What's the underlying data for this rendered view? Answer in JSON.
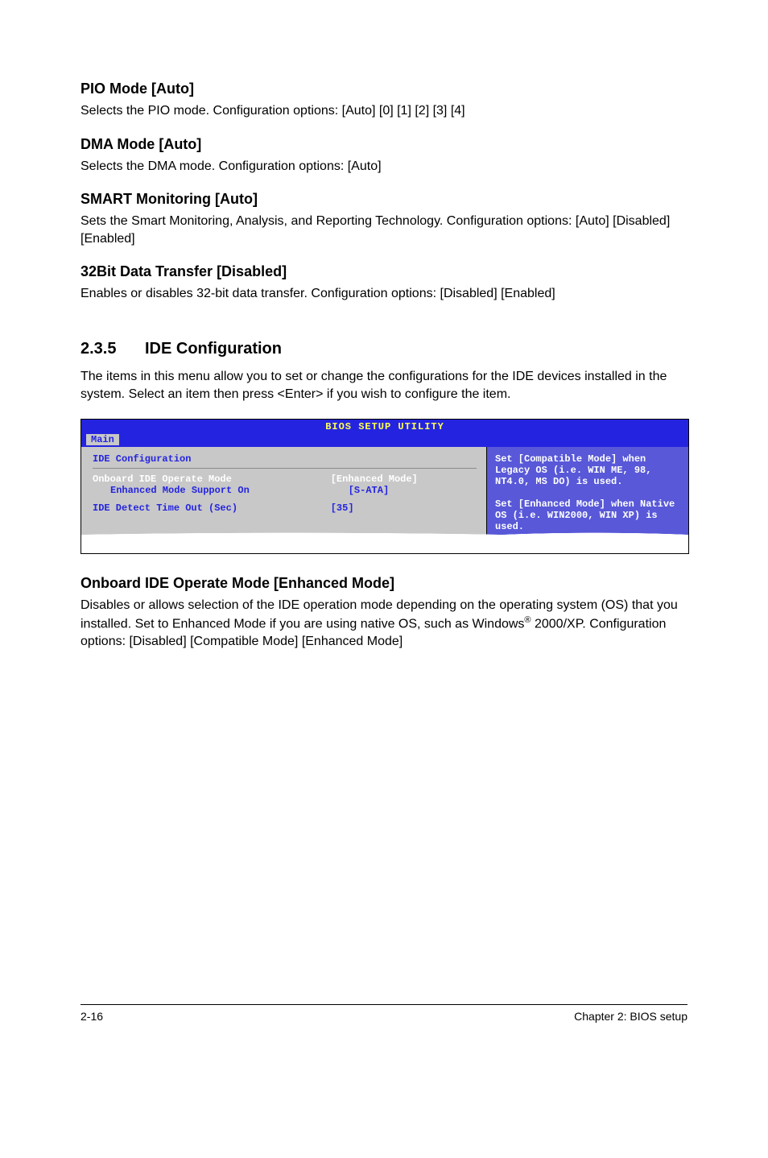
{
  "sections": {
    "pio": {
      "heading": "PIO Mode [Auto]",
      "body": "Selects the PIO mode. Configuration options: [Auto] [0] [1] [2] [3] [4]"
    },
    "dma": {
      "heading": "DMA Mode [Auto]",
      "body": "Selects the DMA mode. Configuration options: [Auto]"
    },
    "smart": {
      "heading": "SMART Monitoring [Auto]",
      "body": "Sets the Smart Monitoring, Analysis, and Reporting Technology. Configuration options: [Auto] [Disabled] [Enabled]"
    },
    "bit32": {
      "heading": "32Bit Data Transfer [Disabled]",
      "body": "Enables or disables 32-bit data transfer. Configuration options: [Disabled] [Enabled]"
    },
    "ide_conf": {
      "number": "2.3.5",
      "title": "IDE Configuration",
      "intro": "The items in this menu allow you to set or change the configurations for the IDE devices installed in the system. Select an item then press <Enter> if you wish to configure the item."
    },
    "onboard": {
      "heading": "Onboard IDE Operate Mode [Enhanced Mode]",
      "body_pre": "Disables or allows selection of the IDE operation mode depending on the operating system (OS) that you installed. Set to Enhanced Mode if you are using native OS, such as Windows",
      "body_post": " 2000/XP. Configuration options: [Disabled] [Compatible Mode] [Enhanced Mode]",
      "reg": "®"
    }
  },
  "bios": {
    "header": "BIOS SETUP UTILITY",
    "active_tab": "Main",
    "left": {
      "title": "IDE Configuration",
      "rows": [
        {
          "label": "Onboard IDE Operate Mode",
          "value": "[Enhanced Mode]",
          "highlight": true,
          "indent": false
        },
        {
          "label": "Enhanced Mode Support On",
          "value": "[S-ATA]",
          "highlight": false,
          "indent": true
        },
        {
          "label": "IDE Detect Time Out (Sec)",
          "value": "[35]",
          "highlight": false,
          "indent": false,
          "space_before": true
        }
      ]
    },
    "help": "Set [Compatible Mode] when Legacy OS (i.e. WIN ME, 98, NT4.0, MS DO) is used.\n\nSet [Enhanced Mode] when Native OS (i.e. WIN2000, WIN XP) is used."
  },
  "footer": {
    "left": "2-16",
    "right": "Chapter 2: BIOS setup"
  }
}
